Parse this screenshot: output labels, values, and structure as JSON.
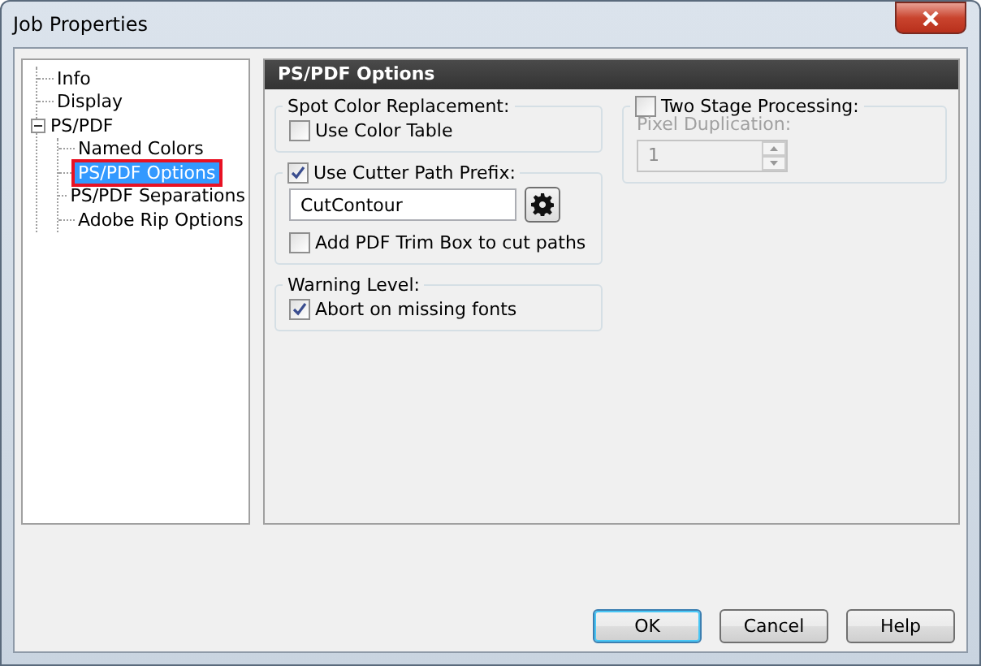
{
  "window": {
    "title": "Job Properties"
  },
  "tree": [
    {
      "label": "Info",
      "selected": false
    },
    {
      "label": "Display",
      "selected": false
    },
    {
      "label": "PS/PDF",
      "selected": false,
      "expanded": true,
      "children": [
        {
          "label": "Named Colors",
          "selected": false
        },
        {
          "label": "PS/PDF Options",
          "selected": true
        },
        {
          "label": "PS/PDF Separations",
          "selected": false
        },
        {
          "label": "Adobe Rip Options",
          "selected": false
        }
      ]
    }
  ],
  "panel": {
    "title": "PS/PDF Options",
    "left_groups": [
      {
        "legend": {
          "kind": "text",
          "label": "Spot Color Replacement:"
        },
        "items": [
          {
            "kind": "checkbox",
            "label": "Use Color Table",
            "checked": false,
            "disabled": false
          }
        ]
      },
      {
        "legend": {
          "kind": "checkbox",
          "label": "Use Cutter Path Prefix:",
          "checked": true,
          "disabled": false
        },
        "items": [
          {
            "kind": "field",
            "value": "CutContour"
          },
          {
            "kind": "checkbox",
            "label": "Add PDF Trim Box to cut paths",
            "checked": false,
            "disabled": false
          }
        ]
      },
      {
        "legend": {
          "kind": "text",
          "label": "Warning Level:"
        },
        "items": [
          {
            "kind": "checkbox",
            "label": "Abort on missing fonts",
            "checked": true,
            "disabled": false
          }
        ]
      }
    ],
    "right_groups": [
      {
        "legend": {
          "kind": "checkbox",
          "label": "Two Stage Processing:",
          "checked": false,
          "disabled": false
        },
        "items": [
          {
            "kind": "label",
            "label": "Pixel Duplication:",
            "disabled": true
          },
          {
            "kind": "spinner",
            "value": "1",
            "disabled": true
          }
        ]
      }
    ]
  },
  "buttons": [
    {
      "label": "OK",
      "default": true
    },
    {
      "label": "Cancel",
      "default": false
    },
    {
      "label": "Help",
      "default": false
    }
  ]
}
